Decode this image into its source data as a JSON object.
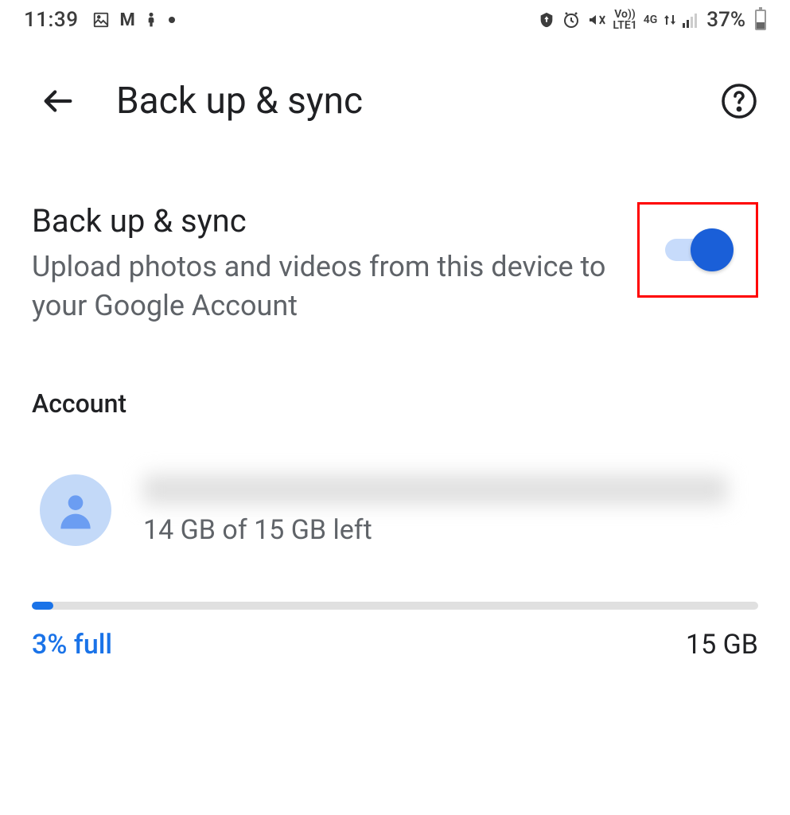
{
  "status_bar": {
    "time": "11:39",
    "battery_percent": "37%",
    "network_label_1": "Vo))\nLTE1",
    "network_label_2": "4G"
  },
  "header": {
    "title": "Back up & sync"
  },
  "setting": {
    "title": "Back up & sync",
    "description": "Upload photos and videos from this device to your Google Account",
    "toggle_on": true
  },
  "account": {
    "section_label": "Account",
    "storage_text": "14 GB of 15 GB left"
  },
  "storage": {
    "percent_label": "3% full",
    "total_label": "15 GB",
    "fill_percent": 3
  }
}
